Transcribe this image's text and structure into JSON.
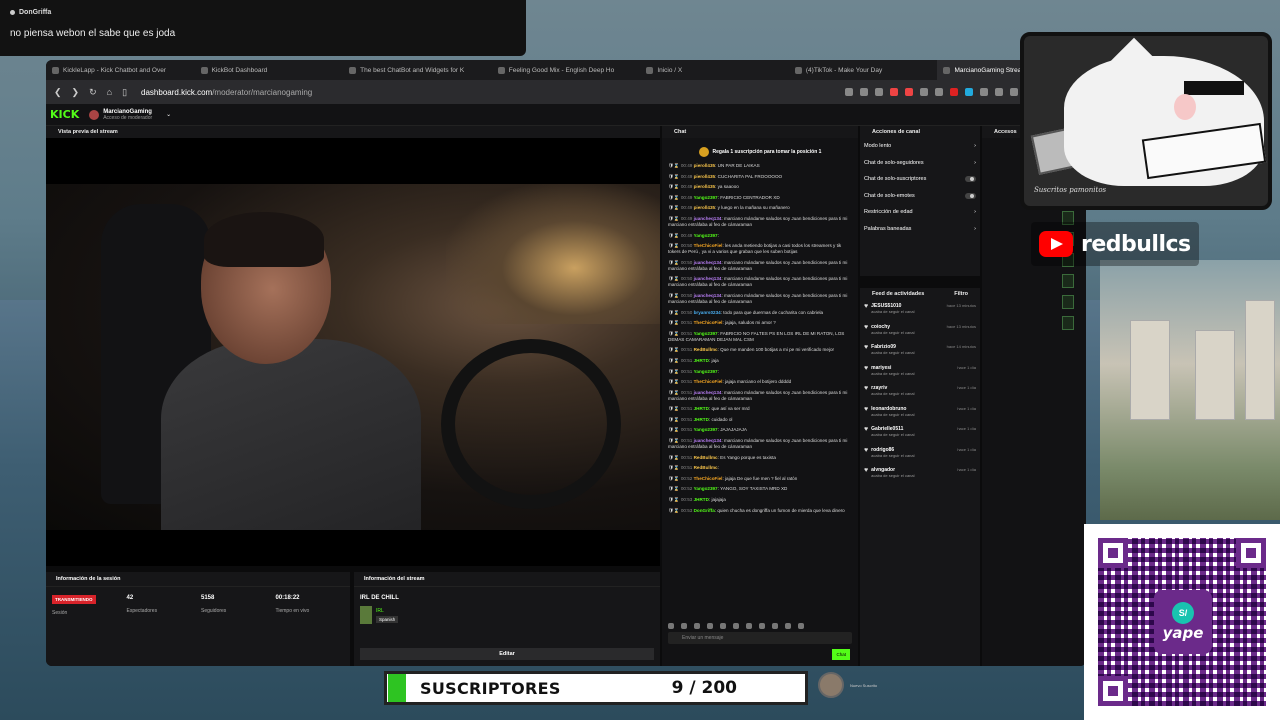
{
  "popup": {
    "user": "DonGriffa",
    "message": "no piensa webon el sabe que es joda"
  },
  "tabs": [
    {
      "label": "KickleLapp - Kick Chatbot and Over"
    },
    {
      "label": "KickBot Dashboard"
    },
    {
      "label": "The best ChatBot and Widgets for K"
    },
    {
      "label": "Feeling Good Mix - English Deep Ho"
    },
    {
      "label": "Inicio / X"
    },
    {
      "label": "(4)TikTok - Make Your Day"
    },
    {
      "label": "MarcianoGaming Stream - K"
    }
  ],
  "url": {
    "host": "dashboard.kick.com",
    "path": "/moderator/marcianogaming"
  },
  "kick": {
    "logo": "KICK",
    "channel": "MarcianoGaming",
    "role": "Acceso de moderador"
  },
  "preview": {
    "title": "Vista previa del stream"
  },
  "session": {
    "title": "Información de la sesión",
    "status": "TRANSMITIENDO",
    "status_label": "Sesión",
    "viewers": "42",
    "viewers_label": "Espectadores",
    "followers": "5158",
    "followers_label": "Seguidores",
    "uptime": "00:18:22",
    "uptime_label": "Tiempo en vivo"
  },
  "stream_info": {
    "title": "Información del stream",
    "name": "IRL DE CHILL",
    "category": "IRL",
    "language": "Spanish",
    "edit": "Editar"
  },
  "chat": {
    "title": "Chat",
    "pinned": "Regala 1 suscripción para tomar la posición 1",
    "messages": [
      {
        "time": "00:49",
        "user": "pieroll435",
        "text": "UN PAR DE LAIKAS",
        "color": "#f3c14a"
      },
      {
        "time": "00:49",
        "user": "pieroll435",
        "text": "CUCHARITA PAL FROOOOOO",
        "color": "#f3c14a"
      },
      {
        "time": "00:49",
        "user": "pieroll435",
        "text": "ya saaooo",
        "color": "#f3c14a"
      },
      {
        "time": "00:49",
        "user": "Yango2397",
        "text": "FABRICIO CENTRADOR XD",
        "color": "#53fc18"
      },
      {
        "time": "00:49",
        "user": "pieroll435",
        "text": "y luego en la mañana su mañanero",
        "color": "#f3c14a"
      },
      {
        "time": "00:49",
        "user": "juancheq134",
        "text": "marciano mándame saludos soy Juan bendiciones para ti mi marciano entráfaba al feo de cámaraman",
        "color": "#b57cf0"
      },
      {
        "time": "00:49",
        "user": "Yango2397",
        "text": "",
        "color": "#53fc18"
      },
      {
        "time": "00:50",
        "user": "TheChicoFiel",
        "text": "les anda metiendo botijas a casi todos los streamers y tik tokers de Perú , ya vi a varios que graban que les suben botijas",
        "color": "#f5a623"
      },
      {
        "time": "00:50",
        "user": "juancheq134",
        "text": "marciano mándame saludos soy Juan bendiciones para ti mi marciano entráfaba al feo de cámaraman",
        "color": "#b57cf0"
      },
      {
        "time": "00:50",
        "user": "juancheq134",
        "text": "marciano mándame saludos soy Juan bendiciones para ti mi marciano entráfaba al feo de cámaraman",
        "color": "#b57cf0"
      },
      {
        "time": "00:50",
        "user": "juancheq134",
        "text": "marciano mándame saludos soy Juan bendiciones para ti mi marciano entráfaba al feo de cámaraman",
        "color": "#b57cf0"
      },
      {
        "time": "00:50",
        "user": "bryanrs0234",
        "text": "todo para que duermas de cucharita con cabriela",
        "color": "#4ab0f3"
      },
      {
        "time": "00:51",
        "user": "TheChicoFiel",
        "text": "jajaja, saludos mi amor ?",
        "color": "#f5a623"
      },
      {
        "time": "00:51",
        "user": "Yango2397",
        "text": "FABRICIO NO FALTES PS EN LOS IRL DE MI RATON, LOS DEMAS CAMARAMAN DEJAN MAL CSM",
        "color": "#53fc18"
      },
      {
        "time": "00:51",
        "user": "RedBullmc",
        "text": "Que me manden 100 botijas a mi pe mi verificado mejor",
        "color": "#f3c14a"
      },
      {
        "time": "00:51",
        "user": "JHRTD",
        "text": "jaja",
        "color": "#53fc18"
      },
      {
        "time": "00:51",
        "user": "Yango2397",
        "text": "",
        "color": "#53fc18"
      },
      {
        "time": "00:51",
        "user": "TheChicoFiel",
        "text": "jajaja marciano el botijero ddddd",
        "color": "#f5a623"
      },
      {
        "time": "00:51",
        "user": "juancheq134",
        "text": "marciano mándame saludos soy Juan bendiciones para ti mi marciano entráfaba al feo de cámaraman",
        "color": "#b57cf0"
      },
      {
        "time": "00:51",
        "user": "JHRTD",
        "text": "que así va ser mrd",
        "color": "#53fc18"
      },
      {
        "time": "00:51",
        "user": "JHRTD",
        "text": "cuidado ol",
        "color": "#53fc18"
      },
      {
        "time": "00:51",
        "user": "Yango2397",
        "text": "JAJAJAJAJA",
        "color": "#53fc18"
      },
      {
        "time": "00:51",
        "user": "juancheq134",
        "text": "marciano mándame saludos soy Juan bendiciones para ti mi marciano entráfaba al feo de cámaraman",
        "color": "#b57cf0"
      },
      {
        "time": "00:51",
        "user": "RedBullmc",
        "text": "Es Yango porque es taxista",
        "color": "#f3c14a"
      },
      {
        "time": "00:51",
        "user": "RedBullmc",
        "text": "",
        "color": "#f3c14a"
      },
      {
        "time": "00:52",
        "user": "TheChicoFiel",
        "text": "jajaja De que fue men ? fiel al ratón",
        "color": "#f5a623"
      },
      {
        "time": "00:52",
        "user": "Yango2397",
        "text": "YANGO, SOY TAXISTA MRD XD",
        "color": "#53fc18"
      },
      {
        "time": "00:53",
        "user": "JHRTD",
        "text": "jajajaja",
        "color": "#53fc18"
      },
      {
        "time": "00:53",
        "user": "DonGriffa",
        "text": "quien chucha es dongriffa un fumon de mierda que leva dinero",
        "color": "#53fc18"
      }
    ],
    "input_placeholder": "Enviar un mensaje",
    "send": "Chat"
  },
  "actions": {
    "title": "Acciones de canal",
    "items": [
      "Modo lento",
      "Chat de solo-seguidores",
      "Chat de solo-suscriptores",
      "Chat de solo-emotes",
      "Restricción de edad",
      "Palabras baneadas"
    ]
  },
  "feed": {
    "title": "Feed de actividades",
    "filter": "Filtro",
    "items": [
      {
        "user": "JESUS51010",
        "action": "acaba de seguir el canal",
        "time": "hace 13 minutos"
      },
      {
        "user": "coiochy",
        "action": "acaba de seguir el canal",
        "time": "hace 13 minutos"
      },
      {
        "user": "Fabrizio09",
        "action": "acaba de seguir el canal",
        "time": "hace 14 minutos"
      },
      {
        "user": "mariyesi",
        "action": "acaba de seguir el canal",
        "time": "hace 1 día"
      },
      {
        "user": "rzayriv",
        "action": "acaba de seguir el canal",
        "time": "hace 1 día"
      },
      {
        "user": "leonardobruno",
        "action": "acaba de seguir el canal",
        "time": "hace 1 día"
      },
      {
        "user": "Gabrielle0511",
        "action": "acaba de seguir el canal",
        "time": "hace 1 día"
      },
      {
        "user": "rodrigo86",
        "action": "acaba de seguir el canal",
        "time": "hace 1 día"
      },
      {
        "user": "alvngador",
        "action": "acaba de seguir el canal",
        "time": "hace 1 día"
      }
    ]
  },
  "accesos": {
    "title": "Accesos"
  },
  "overlay": {
    "youtube_name": "redbullcs",
    "cam_sign": "Suscritos pamonitos",
    "qr_brand": "yape",
    "qr_symbol": "S/",
    "subs_label": "SUSCRIPTORES",
    "subs_value": "9 / 200",
    "recent_label": "Nuevo Suscrito"
  }
}
